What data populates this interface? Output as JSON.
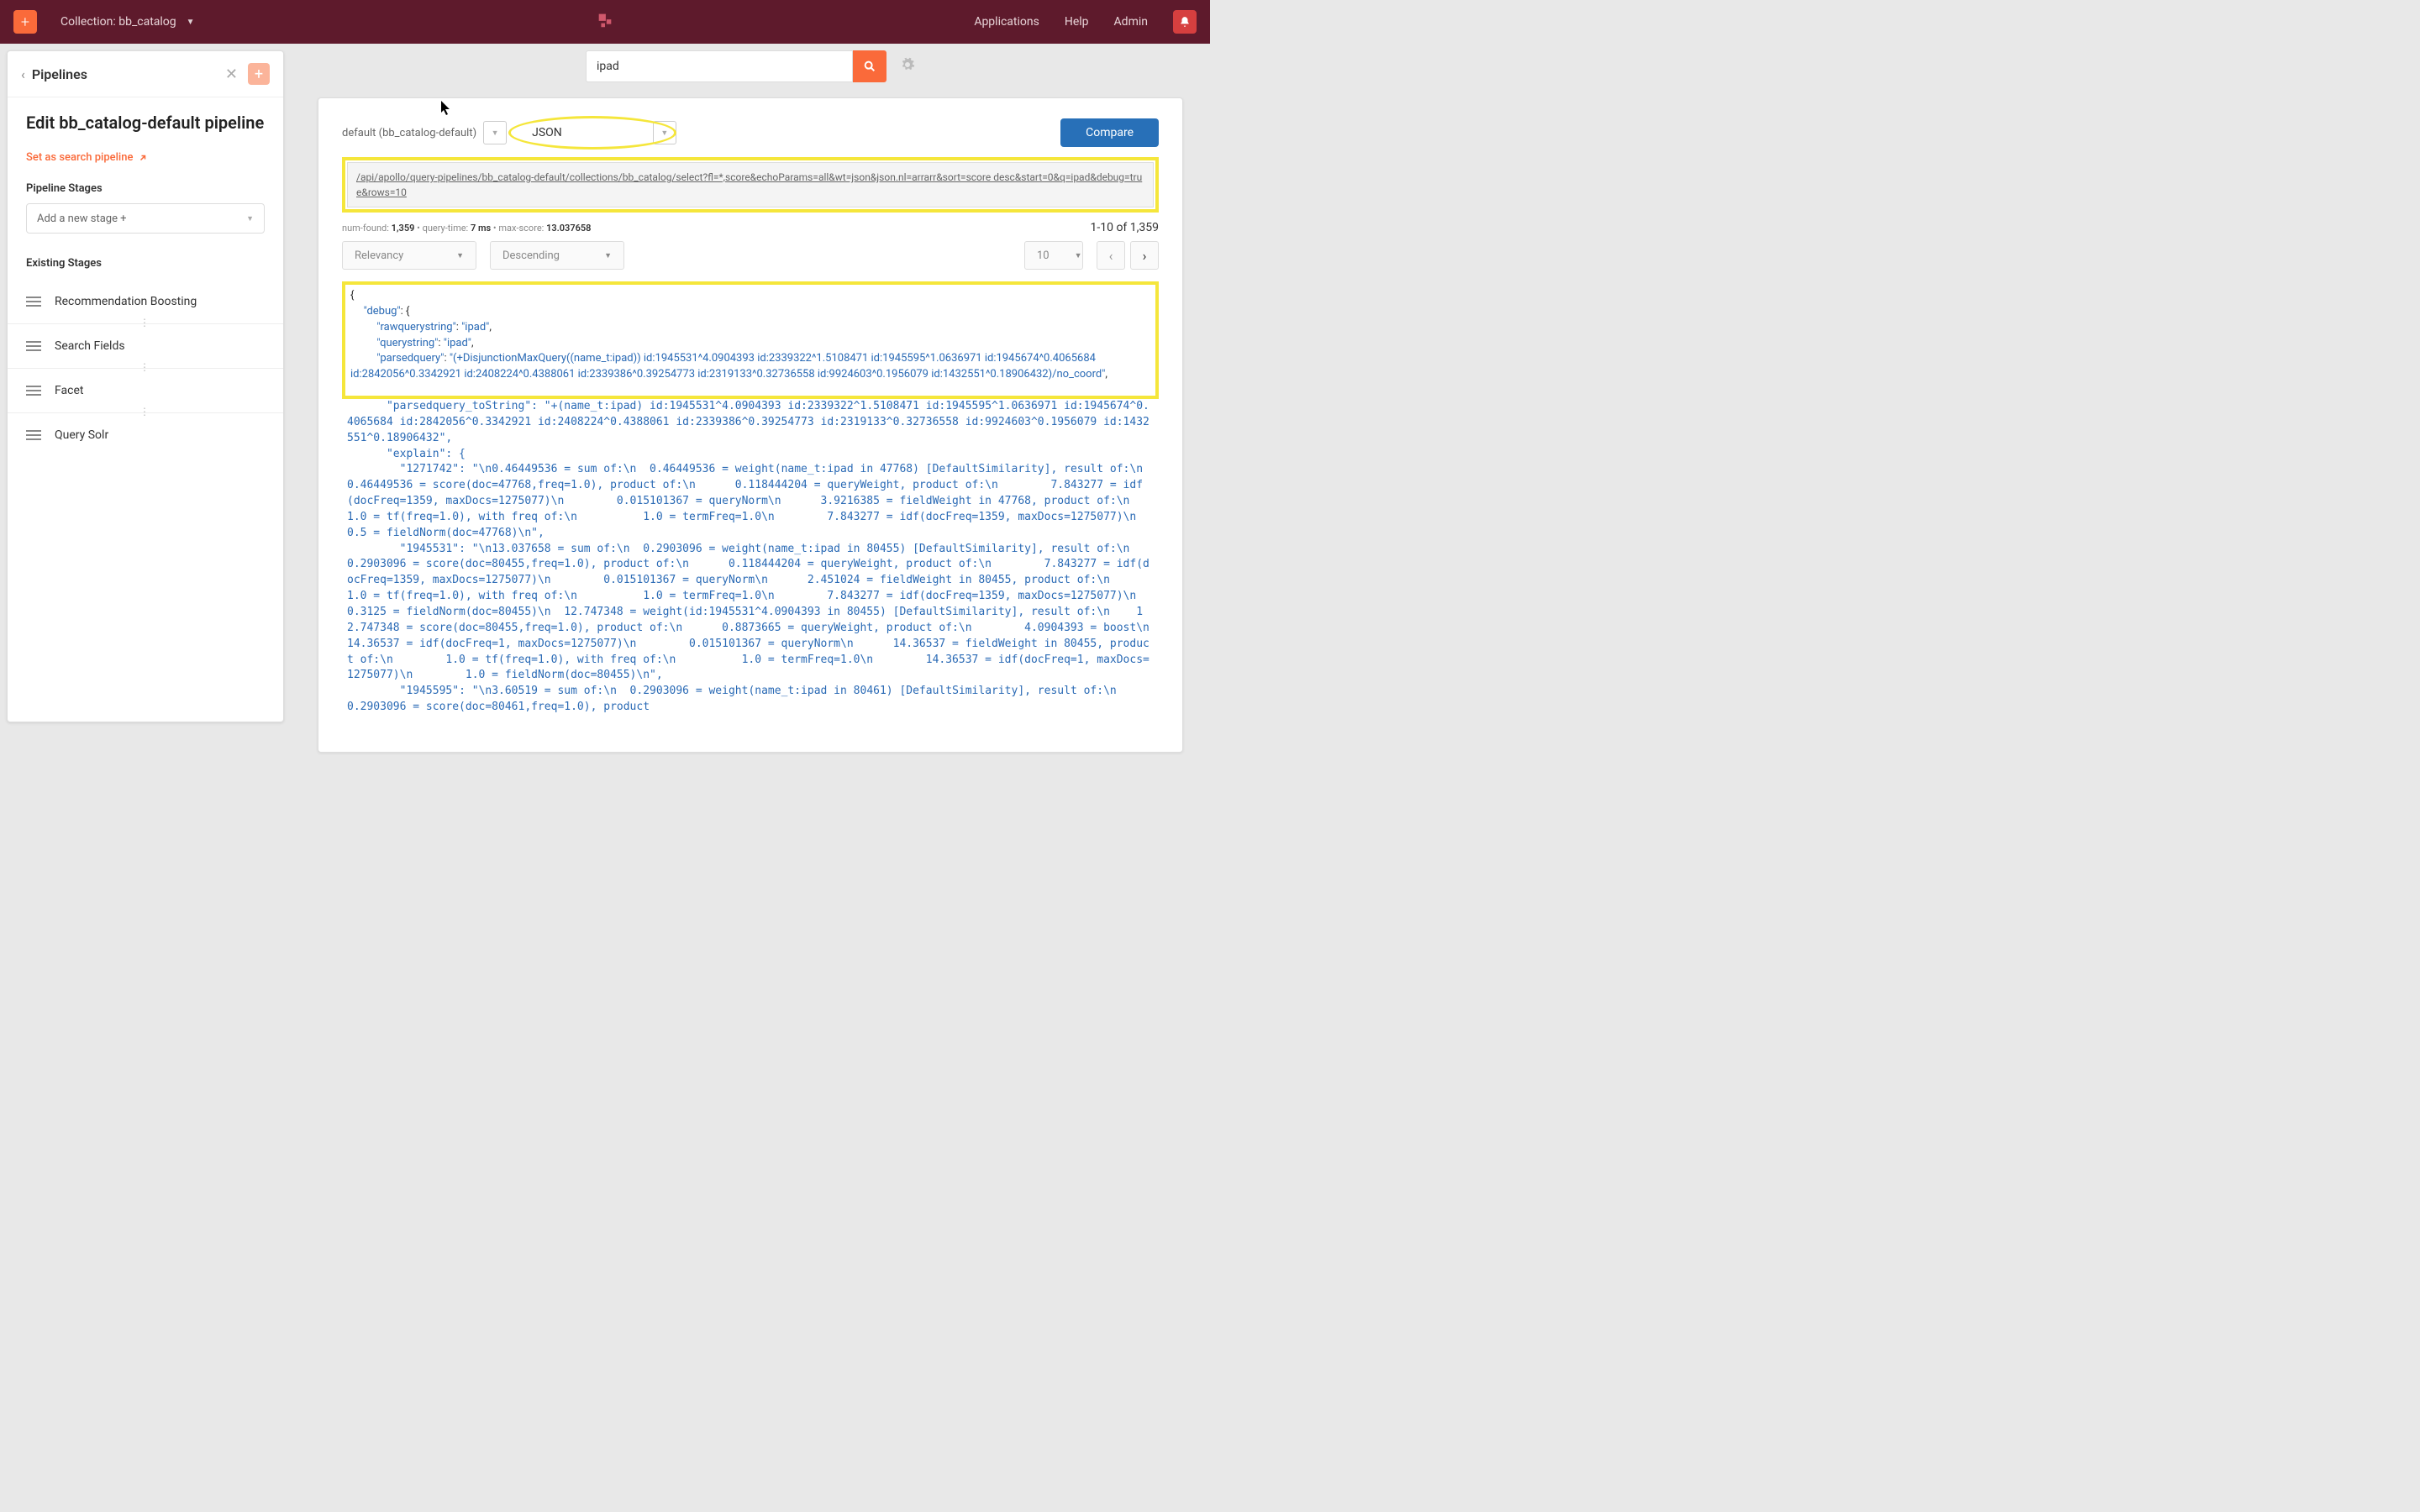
{
  "topbar": {
    "collection_label": "Collection: bb_catalog",
    "nav": {
      "applications": "Applications",
      "help": "Help",
      "admin": "Admin"
    }
  },
  "sidebar": {
    "title": "Pipelines",
    "edit_title": "Edit bb_catalog-default pipeline",
    "set_link": "Set as search pipeline",
    "stages_label": "Pipeline Stages",
    "add_stage_placeholder": "Add a new stage +",
    "existing_label": "Existing Stages",
    "stages": [
      "Recommendation Boosting",
      "Search Fields",
      "Facet",
      "Query Solr"
    ]
  },
  "search": {
    "value": "ipad"
  },
  "controls": {
    "pipeline_label": "default (bb_catalog-default)",
    "format_label": "JSON",
    "compare_label": "Compare"
  },
  "url": "/api/apollo/query-pipelines/bb_catalog-default/collections/bb_catalog/select?fl=*,score&echoParams=all&wt=json&json.nl=arrarr&sort=score desc&start=0&q=ipad&debug=true&rows=10",
  "stats": {
    "num_found_label": "num-found:",
    "num_found": "1,359",
    "query_time_label": "query-time:",
    "query_time": "7 ms",
    "max_score_label": "max-score:",
    "max_score": "13.037658",
    "range": "1-10 of 1,359"
  },
  "filters": {
    "relevancy": "Relevancy",
    "order": "Descending",
    "page_size": "10"
  },
  "json_top": {
    "debug_key": "\"debug\"",
    "raw_key": "\"rawquerystring\"",
    "raw_val": "\"ipad\"",
    "qs_key": "\"querystring\"",
    "qs_val": "\"ipad\"",
    "pq_key": "\"parsedquery\"",
    "pq_val": "\"(+DisjunctionMaxQuery((name_t:ipad)) id:1945531^4.0904393 id:2339322^1.5108471 id:1945595^1.0636971 id:1945674^0.4065684 id:2842056^0.3342921 id:2408224^0.4388061 id:2339386^0.39254773 id:2319133^0.32736558 id:9924603^0.1956079 id:1432551^0.18906432)/no_coord\""
  },
  "json_rest": "      \"parsedquery_toString\": \"+(name_t:ipad) id:1945531^4.0904393 id:2339322^1.5108471 id:1945595^1.0636971 id:1945674^0.4065684 id:2842056^0.3342921 id:2408224^0.4388061 id:2339386^0.39254773 id:2319133^0.32736558 id:9924603^0.1956079 id:1432551^0.18906432\",\n      \"explain\": {\n        \"1271742\": \"\\n0.46449536 = sum of:\\n  0.46449536 = weight(name_t:ipad in 47768) [DefaultSimilarity], result of:\\n    0.46449536 = score(doc=47768,freq=1.0), product of:\\n      0.118444204 = queryWeight, product of:\\n        7.843277 = idf(docFreq=1359, maxDocs=1275077)\\n        0.015101367 = queryNorm\\n      3.9216385 = fieldWeight in 47768, product of:\\n        1.0 = tf(freq=1.0), with freq of:\\n          1.0 = termFreq=1.0\\n        7.843277 = idf(docFreq=1359, maxDocs=1275077)\\n        0.5 = fieldNorm(doc=47768)\\n\",\n        \"1945531\": \"\\n13.037658 = sum of:\\n  0.2903096 = weight(name_t:ipad in 80455) [DefaultSimilarity], result of:\\n    0.2903096 = score(doc=80455,freq=1.0), product of:\\n      0.118444204 = queryWeight, product of:\\n        7.843277 = idf(docFreq=1359, maxDocs=1275077)\\n        0.015101367 = queryNorm\\n      2.451024 = fieldWeight in 80455, product of:\\n        1.0 = tf(freq=1.0), with freq of:\\n          1.0 = termFreq=1.0\\n        7.843277 = idf(docFreq=1359, maxDocs=1275077)\\n        0.3125 = fieldNorm(doc=80455)\\n  12.747348 = weight(id:1945531^4.0904393 in 80455) [DefaultSimilarity], result of:\\n    12.747348 = score(doc=80455,freq=1.0), product of:\\n      0.8873665 = queryWeight, product of:\\n        4.0904393 = boost\\n        14.36537 = idf(docFreq=1, maxDocs=1275077)\\n        0.015101367 = queryNorm\\n      14.36537 = fieldWeight in 80455, product of:\\n        1.0 = tf(freq=1.0), with freq of:\\n          1.0 = termFreq=1.0\\n        14.36537 = idf(docFreq=1, maxDocs=1275077)\\n        1.0 = fieldNorm(doc=80455)\\n\",\n        \"1945595\": \"\\n3.60519 = sum of:\\n  0.2903096 = weight(name_t:ipad in 80461) [DefaultSimilarity], result of:\\n    0.2903096 = score(doc=80461,freq=1.0), product"
}
